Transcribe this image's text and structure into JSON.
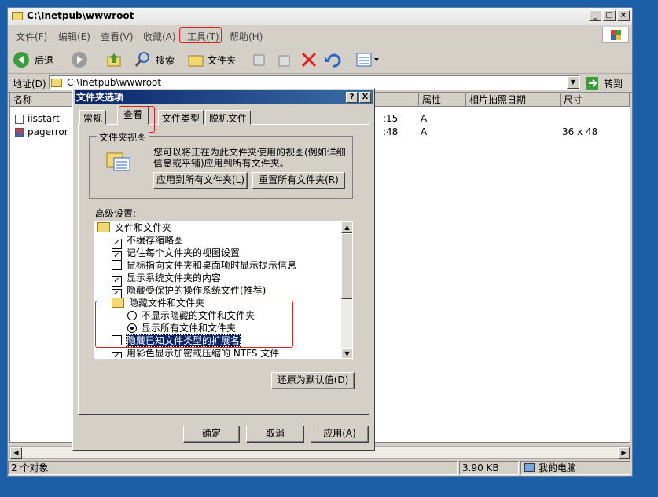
{
  "explorer": {
    "title": "C:\\Inetpub\\wwwroot",
    "menu": [
      "文件(F)",
      "编辑(E)",
      "查看(V)",
      "收藏(A)",
      "工具(T)",
      "帮助(H)"
    ],
    "toolbar": {
      "back": "后退",
      "search": "搜索",
      "folders": "文件夹"
    },
    "address_label": "地址(D)",
    "address_value": "C:\\Inetpub\\wwwroot",
    "go_label": "转到",
    "columns": [
      "名称",
      "属性",
      "相片拍照日期",
      "尺寸"
    ],
    "files": [
      {
        "name": "iisstart",
        "time": ":15",
        "attr": "A",
        "size": ""
      },
      {
        "name": "pagerror",
        "time": ":48",
        "attr": "A",
        "size": "36 x 48"
      }
    ],
    "status": {
      "count": "2 个对象",
      "size": "3.90 KB",
      "zone": "我的电脑"
    }
  },
  "dialog": {
    "title": "文件夹选项",
    "help_btn": "?",
    "close_btn": "X",
    "tabs": [
      "常规",
      "查看",
      "文件类型",
      "脱机文件"
    ],
    "group_title": "文件夹视图",
    "group_desc_1": "您可以将正在为此文件夹使用的视图(例如详细",
    "group_desc_2": "信息或平铺)应用到所有文件夹。",
    "apply_all": "应用到所有文件夹(L)",
    "reset_all": "重置所有文件夹(R)",
    "advanced_label": "高级设置:",
    "tree": [
      {
        "kind": "folder",
        "label": "文件和文件夹"
      },
      {
        "kind": "check",
        "checked": true,
        "label": "不缓存缩略图"
      },
      {
        "kind": "check",
        "checked": true,
        "label": "记住每个文件夹的视图设置"
      },
      {
        "kind": "check",
        "checked": false,
        "label": "鼠标指向文件夹和桌面项时显示提示信息"
      },
      {
        "kind": "check",
        "checked": true,
        "label": "显示系统文件夹的内容"
      },
      {
        "kind": "check",
        "checked": true,
        "label": "隐藏受保护的操作系统文件(推荐)"
      },
      {
        "kind": "folder",
        "label": "隐藏文件和文件夹"
      },
      {
        "kind": "radio",
        "checked": false,
        "label": "不显示隐藏的文件和文件夹"
      },
      {
        "kind": "radio",
        "checked": true,
        "label": "显示所有文件和文件夹"
      },
      {
        "kind": "check",
        "checked": false,
        "label": "隐藏已知文件类型的扩展名",
        "selected": true
      },
      {
        "kind": "check",
        "checked": true,
        "label": "用彩色显示加密或压缩的 NTFS 文件"
      }
    ],
    "restore_defaults": "还原为默认值(D)",
    "ok": "确定",
    "cancel": "取消",
    "apply": "应用(A)"
  }
}
